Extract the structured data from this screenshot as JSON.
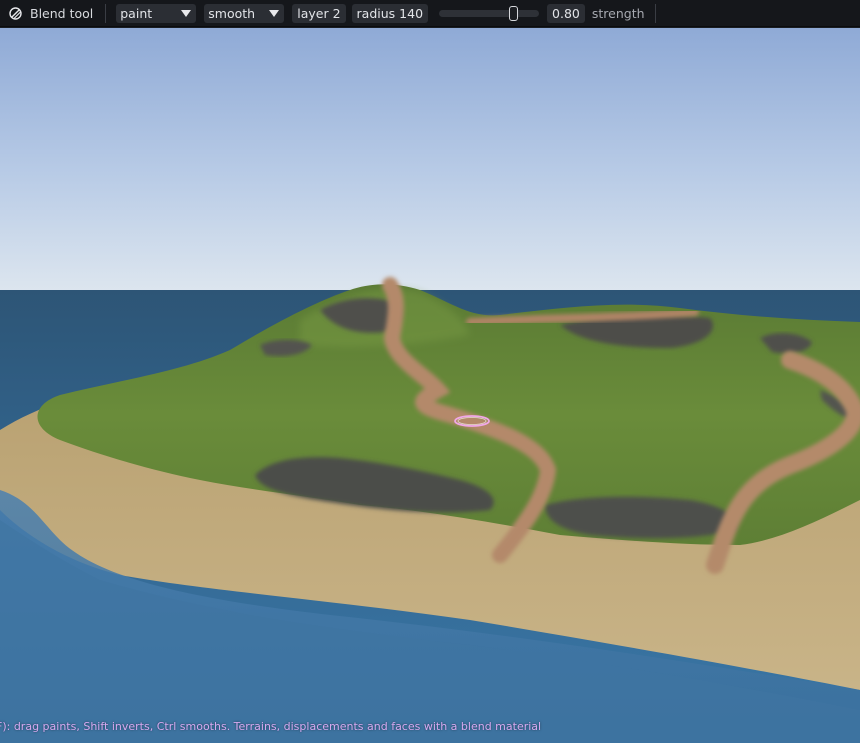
{
  "toolbar": {
    "title": "Blend tool",
    "title_icon": "blend-tool-icon",
    "mode": {
      "selected": "paint"
    },
    "falloff": {
      "selected": "smooth"
    },
    "layer_label": "layer 2",
    "radius_label": "radius 140",
    "radius_slider": {
      "value_fraction": 0.75
    },
    "strength_value": "0.80",
    "strength_label": "strength"
  },
  "status_text": "F): drag paints, Shift inverts, Ctrl smooths. Terrains, displacements and faces with a blend material",
  "colors": {
    "toolbar_bg": "#15171b",
    "status_text": "#d6a9f0",
    "brush_cursor": "#f0a8e8"
  }
}
